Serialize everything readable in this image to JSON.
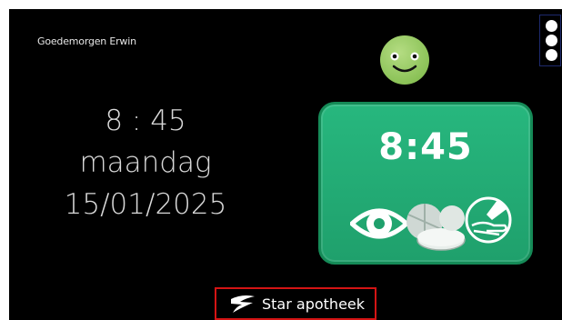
{
  "header": {
    "greeting": "Goedemorgen  Erwin"
  },
  "clock": {
    "time": "8 : 45",
    "day": "maandag",
    "date": "15/01/2025"
  },
  "medication": {
    "time": "8:45",
    "icons": [
      "eye-drops-icon",
      "pills-icon",
      "hand-ointment-icon"
    ],
    "card_color": "#22a873"
  },
  "mood": {
    "icon": "smiley-icon",
    "color": "#9ccc65"
  },
  "menu": {
    "icon": "three-dots-vertical-icon"
  },
  "footer": {
    "pharmacy_name": "Star apotheek",
    "border_color": "#d41414"
  }
}
